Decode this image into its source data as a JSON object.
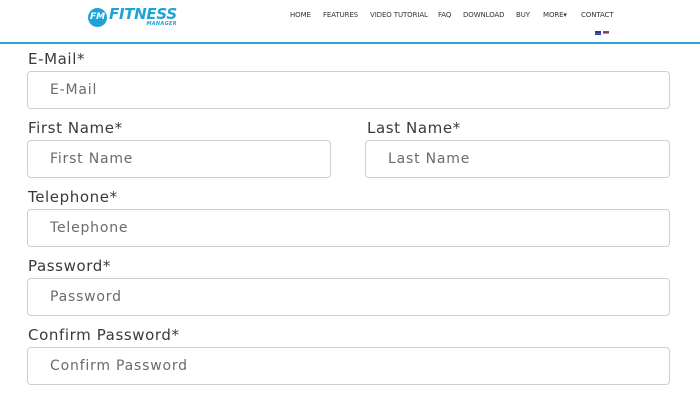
{
  "header": {
    "logo_badge": "FM",
    "logo_word": "FITNESS",
    "logo_sub": "MANAGER",
    "nav": [
      "HOME",
      "FEATURES",
      "VIDEO TUTORIAL",
      "FAQ",
      "DOWNLOAD",
      "BUY",
      "MORE▾",
      "CONTACT"
    ],
    "languages": [
      "uk-flag-icon",
      "serbia-flag-icon"
    ],
    "accent_color": "#2aa6d6"
  },
  "form": {
    "email": {
      "label": "E-Mail*",
      "placeholder": "E-Mail",
      "value": ""
    },
    "first_name": {
      "label": "First Name*",
      "placeholder": "First Name",
      "value": ""
    },
    "last_name": {
      "label": "Last Name*",
      "placeholder": "Last Name",
      "value": ""
    },
    "telephone": {
      "label": "Telephone*",
      "placeholder": "Telephone",
      "value": ""
    },
    "password": {
      "label": "Password*",
      "placeholder": "Password",
      "value": ""
    },
    "confirm_password": {
      "label": "Confirm Password*",
      "placeholder": "Confirm Password",
      "value": ""
    }
  }
}
